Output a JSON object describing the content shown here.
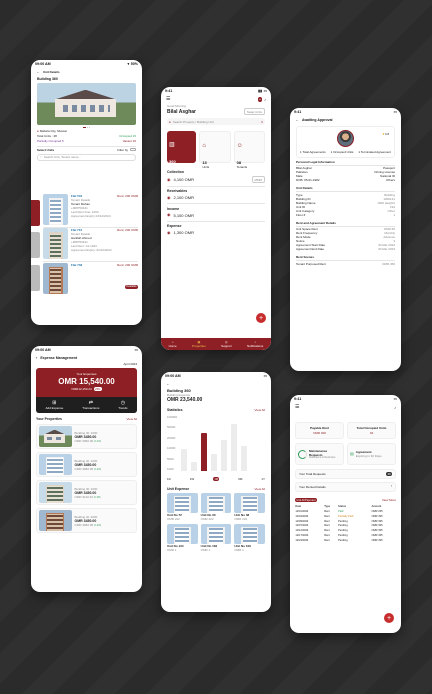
{
  "p1": {
    "time": "09:00 AM",
    "battery": "50%",
    "title": "Unit Details",
    "building": "Building 360",
    "location": "Mabela City, Muscat",
    "total_units": "Total Units : 28",
    "occupied": "Occupied 15",
    "partially": "Partially Occupied 5",
    "vacant": "Vacant 10",
    "select_units": "Select Units",
    "filter": "Filter by",
    "search_placeholder": "Search Unit, Tenant name...",
    "units": [
      {
        "name": "Flat 504",
        "tenant": "Tenant Details",
        "who": "Tenant Mohan",
        "phone": "+968750441",
        "meta": "Last Rent Due: 1000",
        "due": "Agreement Expiry 02/12/2024",
        "amount": "Rent: 200 OMR"
      },
      {
        "name": "Flat 715",
        "tenant": "Tenant Details",
        "who": "Hanifah Ahmed",
        "phone": "+968750441",
        "meta": "Last Rent: Jul 1023",
        "due": "Agreement Expiry: 02/12/2024",
        "amount": "Rent: 200 OMR"
      },
      {
        "name": "Flat 733",
        "tenant": "",
        "who": "",
        "phone": "",
        "meta": "",
        "due": "",
        "amount": "Rent: 200 OMR",
        "badge": "Available"
      }
    ]
  },
  "p2": {
    "time": "9:41",
    "greeting": "Good Morning",
    "name": "Bilal Asghar",
    "switch": "Swap Units",
    "search": "Search Property / Building Unit",
    "cards": [
      {
        "value": "360",
        "label": "Building"
      },
      {
        "value": "13",
        "label": "Units"
      },
      {
        "value": "08",
        "label": "Tenants"
      }
    ],
    "collection": "Collection",
    "collection_value": "4,100 OMR",
    "collection_tag": "MMM",
    "receivables": "Receivables",
    "receivables_value": "2,100 OMR",
    "income": "Income",
    "income_value": "5,100 OMR",
    "expense": "Expense",
    "expense_value": "1,300 OMR",
    "tabs": [
      "Home",
      "Properties",
      "Support",
      "Notifications"
    ]
  },
  "p3": {
    "time": "9:41",
    "title": "Awaiting Approval",
    "rating": "4.8",
    "stat1": "1 Total Agreements",
    "stat2": "1 Occupied Units",
    "stat3": "1 Terminated Agreement",
    "section1": "Personal Legal Information",
    "personal": [
      [
        "Bilal Asghar",
        "Passport"
      ],
      [
        "Pakistan",
        "Driving License"
      ],
      [
        "Male",
        "National ID"
      ],
      [
        "DOB: 05-01-1982",
        "Others"
      ]
    ],
    "section2": "Unit Details",
    "unit": [
      [
        "Type",
        "Building"
      ],
      [
        "Building ID",
        "1000131"
      ],
      [
        "Building Name",
        "1000 Heights"
      ],
      [
        "Unit ID",
        "194"
      ],
      [
        "Unit Category",
        "Other"
      ],
      [
        "Floor #",
        "1"
      ]
    ],
    "section3": "Rent and Agreement Details",
    "rent": [
      [
        "Unit Space Rent",
        "OMR 50"
      ],
      [
        "Rent Frequency",
        "Monthly"
      ],
      [
        "Rent Mode",
        "Advance"
      ],
      [
        "Notice",
        "3"
      ],
      [
        "Agreement Start Date",
        "30 Mar 2022"
      ],
      [
        "Agreement End Date",
        "30 Mar 2023"
      ]
    ],
    "section4": "Rent Scenes",
    "scene": "Tenant Purposed Rent",
    "scene_value": "OMR 450"
  },
  "p4": {
    "time": "09:00 AM",
    "title": "Expense Management",
    "month": "April 2023",
    "your_expenses": "Your Expenses",
    "amount": "OMR 15,540.00",
    "last": "OMR12,150.24",
    "change": "23%",
    "actions": [
      "Add Expense",
      "Transactions",
      "Trends"
    ],
    "properties": "Your Properties",
    "view_all": "View All",
    "items": [
      {
        "name": "Building ID: 1000",
        "amount": "OMR 3450.00",
        "sub": "OMR 3960.00",
        "pct": "3.1%"
      },
      {
        "name": "Building ID: 1000",
        "amount": "OMR 3450.00",
        "sub": "OMR 3960.00",
        "pct": "3.1%"
      },
      {
        "name": "Building ID: 1000",
        "amount": "OMR 3450.00",
        "sub": "OMR 3110.23",
        "pct": "3.1%"
      },
      {
        "name": "Building ID: 2000",
        "amount": "OMR 3450.00",
        "sub": "OMR 3960.00",
        "pct": "3.1%"
      }
    ]
  },
  "p5": {
    "time": "09:00 AM",
    "title": "Building 360",
    "sub": "Building Expense",
    "amount": "OMR 23,540.00",
    "stats": "Statistics",
    "view_all": "View All",
    "ylabels": [
      "100000",
      "50000",
      "20000",
      "10000",
      "5000",
      "1000"
    ],
    "periods": [
      "1D",
      "1W",
      "1M",
      "6M",
      "1Y"
    ],
    "active_period": "1M",
    "unit_expense": "Unit Expense",
    "view_all2": "View All",
    "units": [
      {
        "name": "Unit No 72",
        "sub": "OMR 222"
      },
      {
        "name": "Unit No 30",
        "sub": "OMR 222"
      },
      {
        "name": "Unit No 38",
        "sub": "OMR 222"
      },
      {
        "name": "Unit No 134",
        "sub": "OMR 1"
      },
      {
        "name": "Unit No 184",
        "sub": "OMR 1"
      },
      {
        "name": "Unit No 109",
        "sub": "OMR 1"
      }
    ]
  },
  "p6": {
    "time": "9:41",
    "payable": "Payable Rent",
    "payable_value": "OMR 000",
    "occupied": "Total Occupied Units",
    "occupied_value": "04",
    "maint": "Maintenance Requests",
    "maint_sub": "Notifications & Reminders",
    "agreement": "Agreement",
    "agreement_sub": "Expiring in 30 Days",
    "total_requests": "Your Total Requests",
    "total_value": "08",
    "rented": "Your Rented Details",
    "table_tag": "Unit All Payment",
    "view_more": "View More",
    "headers": [
      "Date",
      "Type",
      "Status",
      "Amount"
    ],
    "rows": [
      [
        "12/01/2024",
        "Rent",
        "Paid",
        "OMR 235"
      ],
      [
        "12/04/2024",
        "Rent",
        "Partially Paid",
        "OMR 335"
      ],
      [
        "12/09/2024",
        "Rent",
        "Pending",
        "OMR 335"
      ],
      [
        "12/07/2024",
        "Rent",
        "Pending",
        "OMR 335"
      ],
      [
        "12/12/2024",
        "Rent",
        "Pending",
        "OMR 335"
      ],
      [
        "12/17/2024",
        "Rent",
        "Pending",
        "OMR 335"
      ],
      [
        "12/23/2024",
        "Rent",
        "Pending",
        "OMR 335"
      ]
    ]
  }
}
